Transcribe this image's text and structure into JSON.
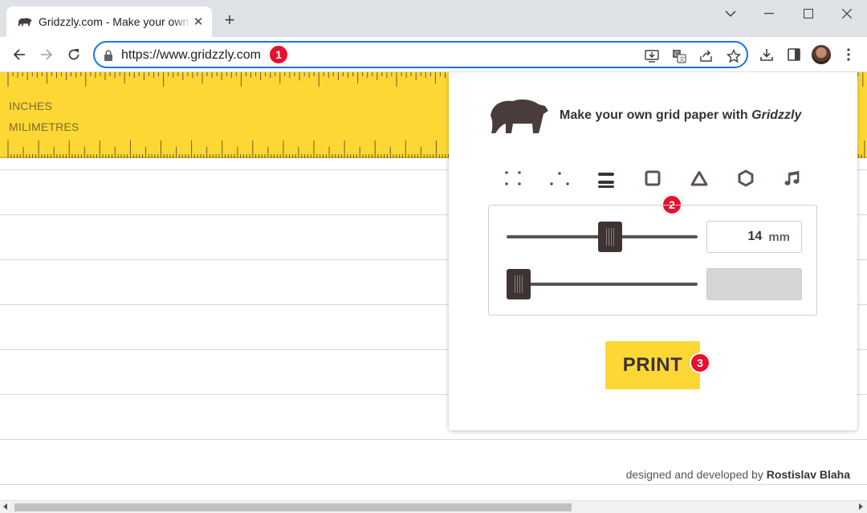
{
  "browser": {
    "tab_title": "Gridzzly.com - Make your own grid paper",
    "url": "https://www.gridzzly.com"
  },
  "ruler": {
    "inches_label": "INCHES",
    "millimetres_label": "MILIMETRES"
  },
  "panel": {
    "title_prefix": "Make your own grid paper with ",
    "title_brand": "Gridzzly",
    "grid_types": [
      "dots-square",
      "dots-triangle",
      "lines",
      "squares",
      "triangles",
      "hexagons",
      "music"
    ],
    "selected_grid_type": "lines",
    "spacing_value": "14",
    "spacing_unit": "mm",
    "spacing_slider_fraction": 0.55,
    "weight_slider_fraction": 0.0,
    "print_label": "PRINT"
  },
  "footer": {
    "credit_prefix": "designed and developed by ",
    "credit_author": "Rostislav Blaha"
  },
  "annotations": {
    "badge_1": "1",
    "badge_2": "2",
    "badge_3": "3",
    "badge_color": "#e8112d"
  },
  "colors": {
    "ruler_yellow": "#fdd835",
    "brand_brown": "#3b3232",
    "address_focus": "#1a73e8"
  }
}
